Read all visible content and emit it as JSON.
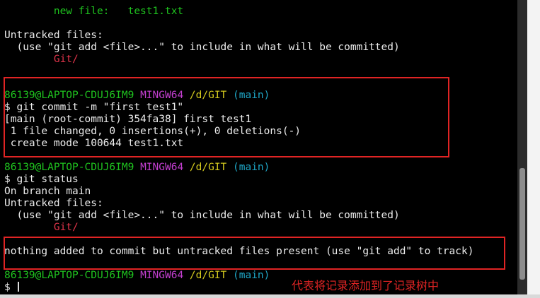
{
  "terminal": {
    "lines": [
      {
        "segments": [
          {
            "text": "        new file:   test1.txt",
            "color": "green"
          }
        ]
      },
      {
        "segments": [
          {
            "text": "",
            "color": "white"
          }
        ]
      },
      {
        "segments": [
          {
            "text": "Untracked files:",
            "color": "white"
          }
        ]
      },
      {
        "segments": [
          {
            "text": "  (use \"git add <file>...\" to include in what will be committed)",
            "color": "white"
          }
        ]
      },
      {
        "segments": [
          {
            "text": "        Git/",
            "color": "red"
          }
        ]
      },
      {
        "segments": [
          {
            "text": "",
            "color": "white"
          }
        ]
      },
      {
        "segments": [
          {
            "text": "",
            "color": "white"
          }
        ]
      },
      {
        "segments": [
          {
            "text": "86139@LAPTOP-CDUJ6IM9 ",
            "color": "green"
          },
          {
            "text": "MINGW64 ",
            "color": "purple"
          },
          {
            "text": "/d/GIT ",
            "color": "yellow"
          },
          {
            "text": "(main)",
            "color": "cyan"
          }
        ]
      },
      {
        "segments": [
          {
            "text": "$ git commit -m \"first test1\"",
            "color": "white"
          }
        ]
      },
      {
        "segments": [
          {
            "text": "[main (root-commit) 354fa38] first test1",
            "color": "white"
          }
        ]
      },
      {
        "segments": [
          {
            "text": " 1 file changed, 0 insertions(+), 0 deletions(-)",
            "color": "white"
          }
        ]
      },
      {
        "segments": [
          {
            "text": " create mode 100644 test1.txt",
            "color": "white"
          }
        ]
      },
      {
        "segments": [
          {
            "text": "",
            "color": "white"
          }
        ]
      },
      {
        "segments": [
          {
            "text": "86139@LAPTOP-CDUJ6IM9 ",
            "color": "green"
          },
          {
            "text": "MINGW64 ",
            "color": "purple"
          },
          {
            "text": "/d/GIT ",
            "color": "yellow"
          },
          {
            "text": "(main)",
            "color": "cyan"
          }
        ]
      },
      {
        "segments": [
          {
            "text": "$ git status",
            "color": "white"
          }
        ]
      },
      {
        "segments": [
          {
            "text": "On branch main",
            "color": "white"
          }
        ]
      },
      {
        "segments": [
          {
            "text": "Untracked files:",
            "color": "white"
          }
        ]
      },
      {
        "segments": [
          {
            "text": "  (use \"git add <file>...\" to include in what will be committed)",
            "color": "white"
          }
        ]
      },
      {
        "segments": [
          {
            "text": "        Git/",
            "color": "red"
          }
        ]
      },
      {
        "segments": [
          {
            "text": "",
            "color": "white"
          }
        ]
      },
      {
        "segments": [
          {
            "text": "nothing added to commit but untracked files present (use \"git add\" to track)",
            "color": "white"
          }
        ]
      },
      {
        "segments": [
          {
            "text": "",
            "color": "white"
          }
        ]
      },
      {
        "segments": [
          {
            "text": "86139@LAPTOP-CDUJ6IM9 ",
            "color": "green"
          },
          {
            "text": "MINGW64 ",
            "color": "purple"
          },
          {
            "text": "/d/GIT ",
            "color": "yellow"
          },
          {
            "text": "(main)",
            "color": "cyan"
          }
        ]
      },
      {
        "segments": [
          {
            "text": "$ ",
            "color": "white"
          }
        ],
        "cursor": true
      }
    ]
  },
  "annotation": {
    "text": "代表将记录添加到了记录树中",
    "color": "#e02424"
  },
  "colors": {
    "background": "#000000",
    "highlight_box": "#e02424",
    "prompt_user": "#1fc41f",
    "prompt_env": "#c33fd0",
    "prompt_path": "#d3c91e",
    "prompt_branch": "#1fa7c7",
    "untracked_file": "#e0344a"
  }
}
